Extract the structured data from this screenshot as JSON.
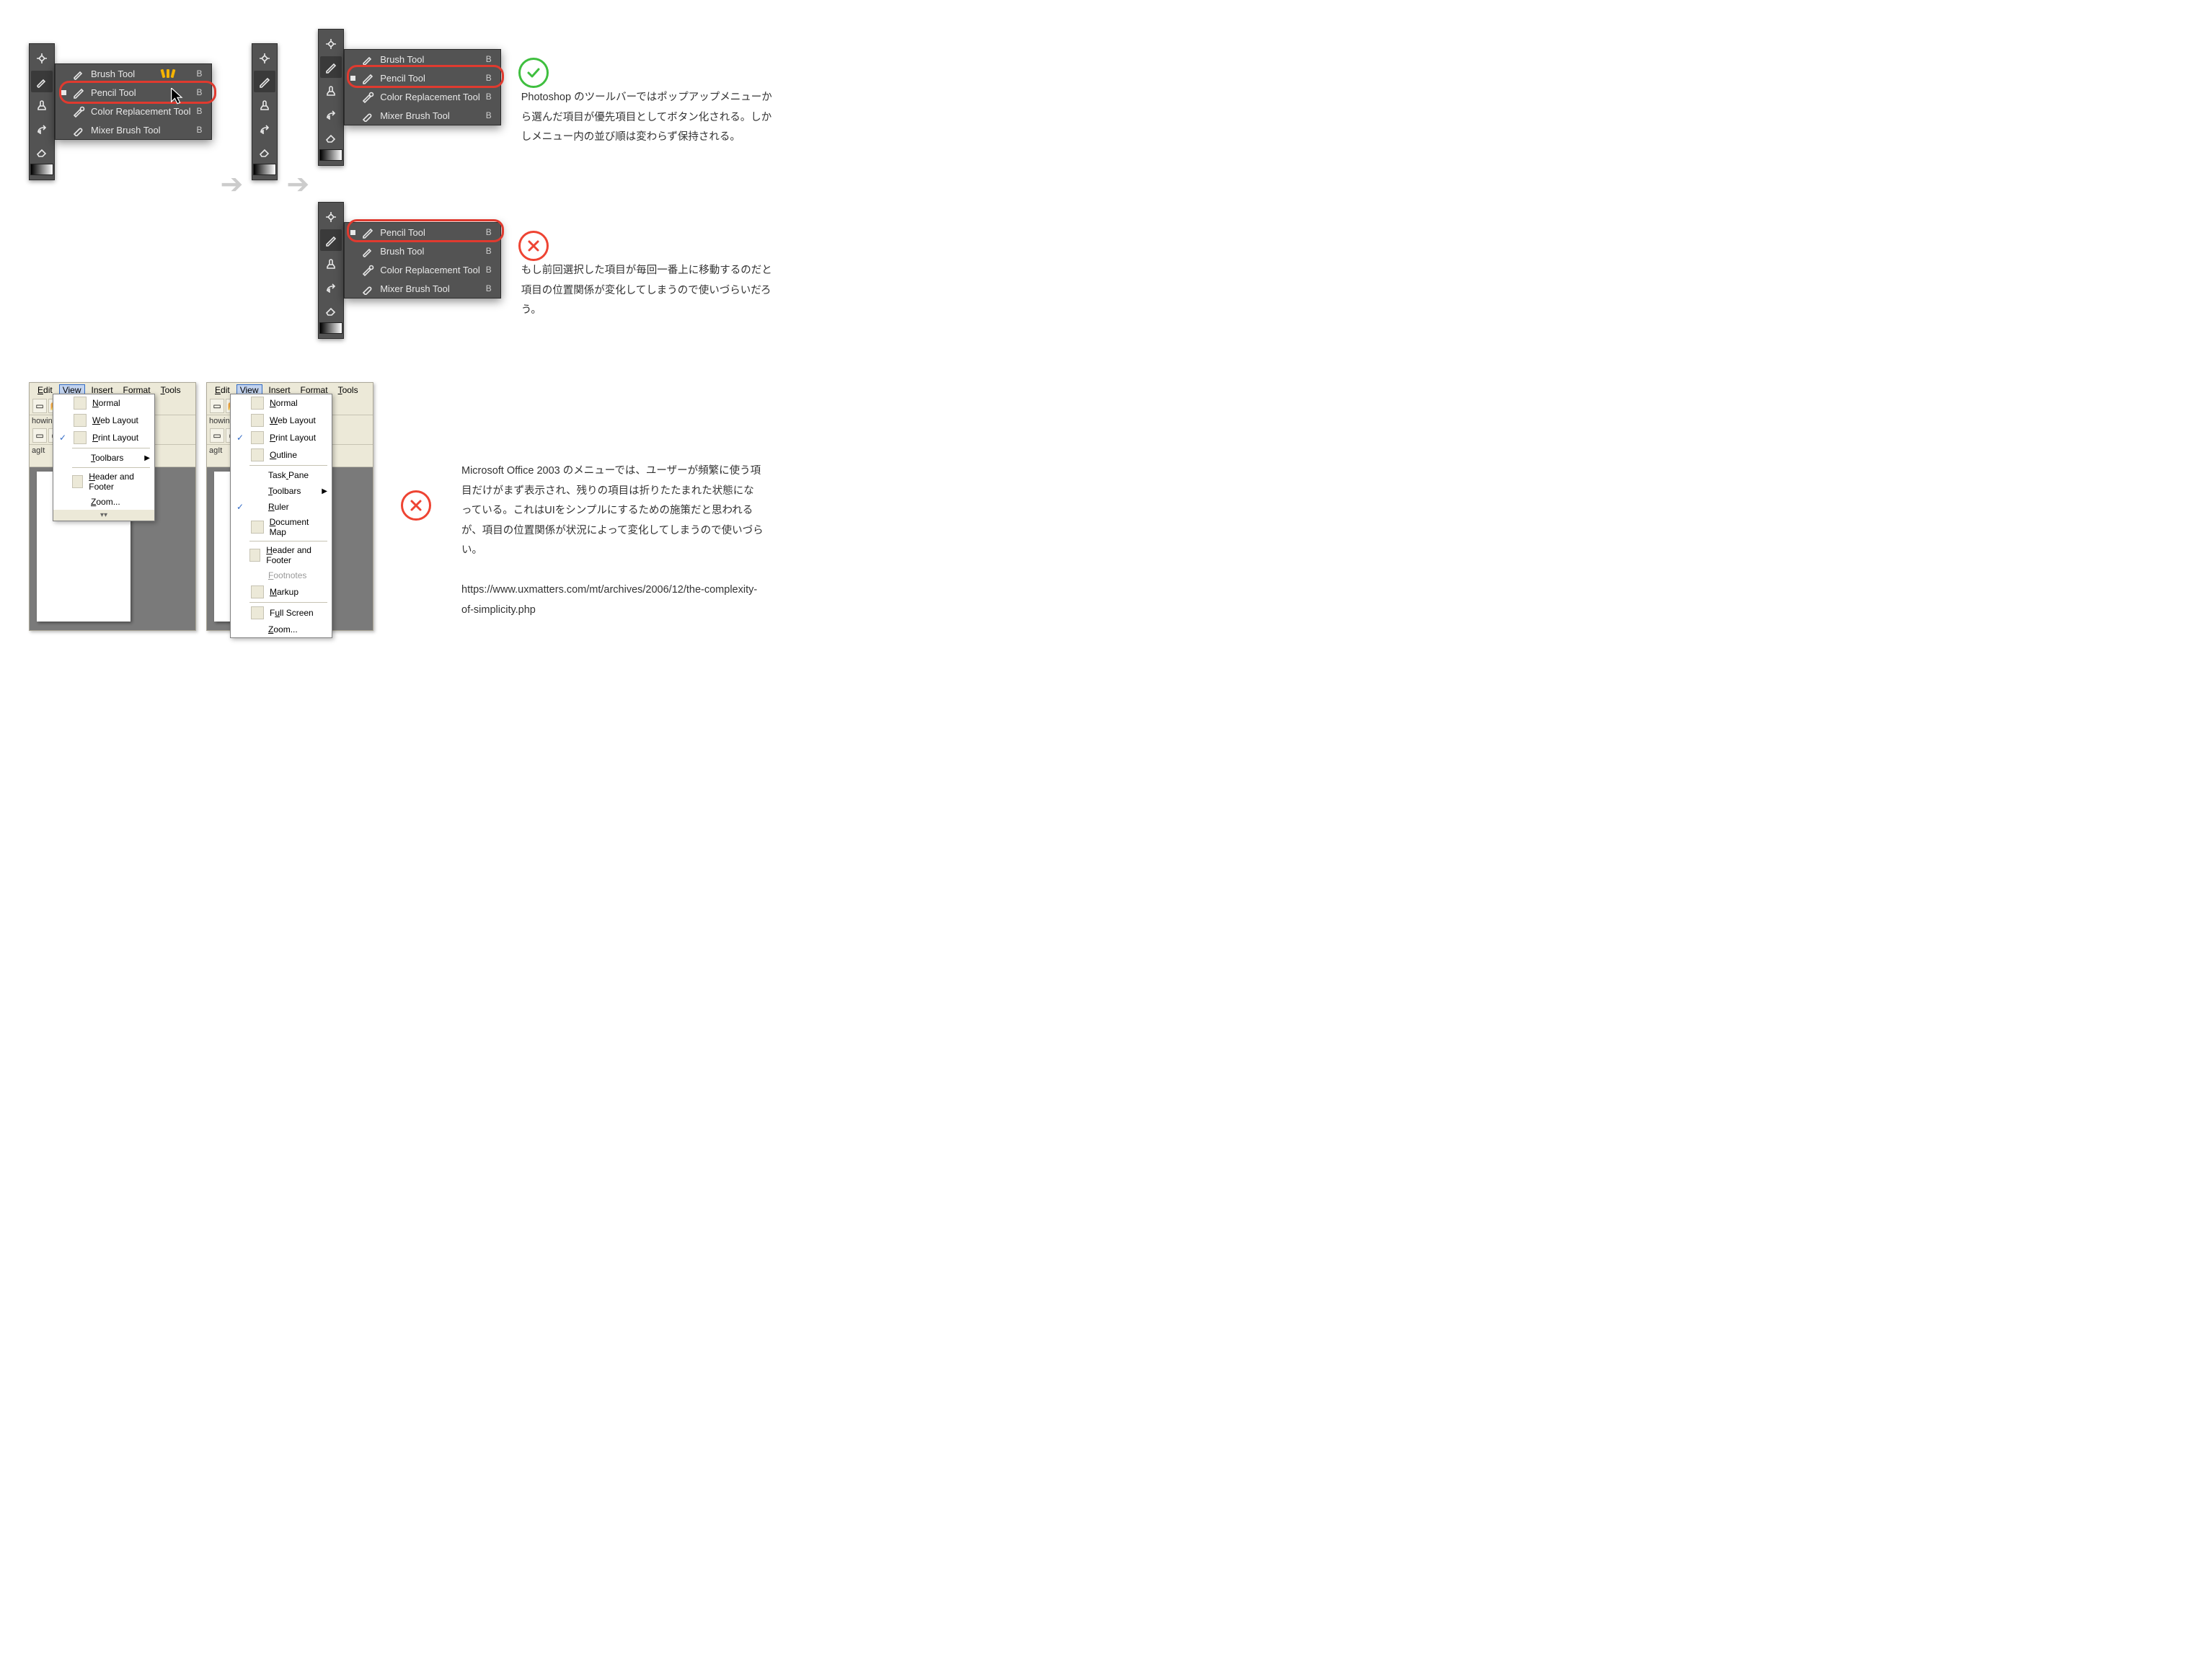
{
  "ps_flyout": {
    "items": [
      {
        "label": "Brush Tool",
        "key": "B",
        "sel": false
      },
      {
        "label": "Pencil Tool",
        "key": "B",
        "sel": true
      },
      {
        "label": "Color Replacement Tool",
        "key": "B",
        "sel": false
      },
      {
        "label": "Mixer Brush Tool",
        "key": "B",
        "sel": false
      }
    ],
    "items_reordered": [
      {
        "label": "Pencil Tool",
        "key": "B",
        "sel": true
      },
      {
        "label": "Brush Tool",
        "key": "B",
        "sel": false
      },
      {
        "label": "Color Replacement Tool",
        "key": "B",
        "sel": false
      },
      {
        "label": "Mixer Brush Tool",
        "key": "B",
        "sel": false
      }
    ]
  },
  "text": {
    "ps_good": "Photoshop のツールバーではポップアップメニューから選んだ項目が優先項目としてボタン化される。しかしメニュー内の並び順は変わらず保持される。",
    "ps_bad": "もし前回選択した項目が毎回一番上に移動するのだと項目の位置関係が変化してしまうので使いづらいだろう。",
    "off": "Microsoft Office 2003 のメニューでは、ユーザーが頻繁に使う項目だけがまず表示され、残りの項目は折りたたまれた状態になっている。これはUIをシンプルにするための施策だと思われるが、項目の位置関係が状況によって変化してしまうので使いづらい。",
    "off_url": "https://www.uxmatters.com/mt/archives/2006/12/the-complexity-of-simplicity.php"
  },
  "office": {
    "menubar": [
      "Edit",
      "View",
      "Insert",
      "Format",
      "Tools"
    ],
    "menubar_sel": 1,
    "tags": [
      "howing",
      "agIt"
    ],
    "short_menu": [
      {
        "label": "Normal",
        "u": 0,
        "icon": "page"
      },
      {
        "label": "Web Layout",
        "u": 0,
        "icon": "globe"
      },
      {
        "label": "Print Layout",
        "u": 0,
        "icon": "page",
        "checked": true
      },
      {
        "sep": true
      },
      {
        "label": "Toolbars",
        "u": 0,
        "sub": true
      },
      {
        "sep": true
      },
      {
        "label": "Header and Footer",
        "u": 0,
        "icon": "page"
      },
      {
        "label": "Zoom...",
        "u": 0
      }
    ],
    "full_menu": [
      {
        "label": "Normal",
        "u": 0,
        "icon": "page"
      },
      {
        "label": "Web Layout",
        "u": 0,
        "icon": "globe"
      },
      {
        "label": "Print Layout",
        "u": 0,
        "icon": "page",
        "checked": true
      },
      {
        "label": "Outline",
        "u": 0,
        "icon": "page"
      },
      {
        "sep": true
      },
      {
        "label": "Task Pane",
        "u": 4
      },
      {
        "label": "Toolbars",
        "u": 0,
        "sub": true
      },
      {
        "label": "Ruler",
        "u": 0,
        "checked": true
      },
      {
        "label": "Document Map",
        "u": 0,
        "icon": "page"
      },
      {
        "sep": true
      },
      {
        "label": "Header and Footer",
        "u": 0,
        "icon": "page"
      },
      {
        "label": "Footnotes",
        "u": 0,
        "dis": true
      },
      {
        "label": "Markup",
        "u": 0,
        "icon": "mark"
      },
      {
        "sep": true
      },
      {
        "label": "Full Screen",
        "u": 1,
        "icon": "screen"
      },
      {
        "label": "Zoom...",
        "u": 0
      }
    ]
  }
}
